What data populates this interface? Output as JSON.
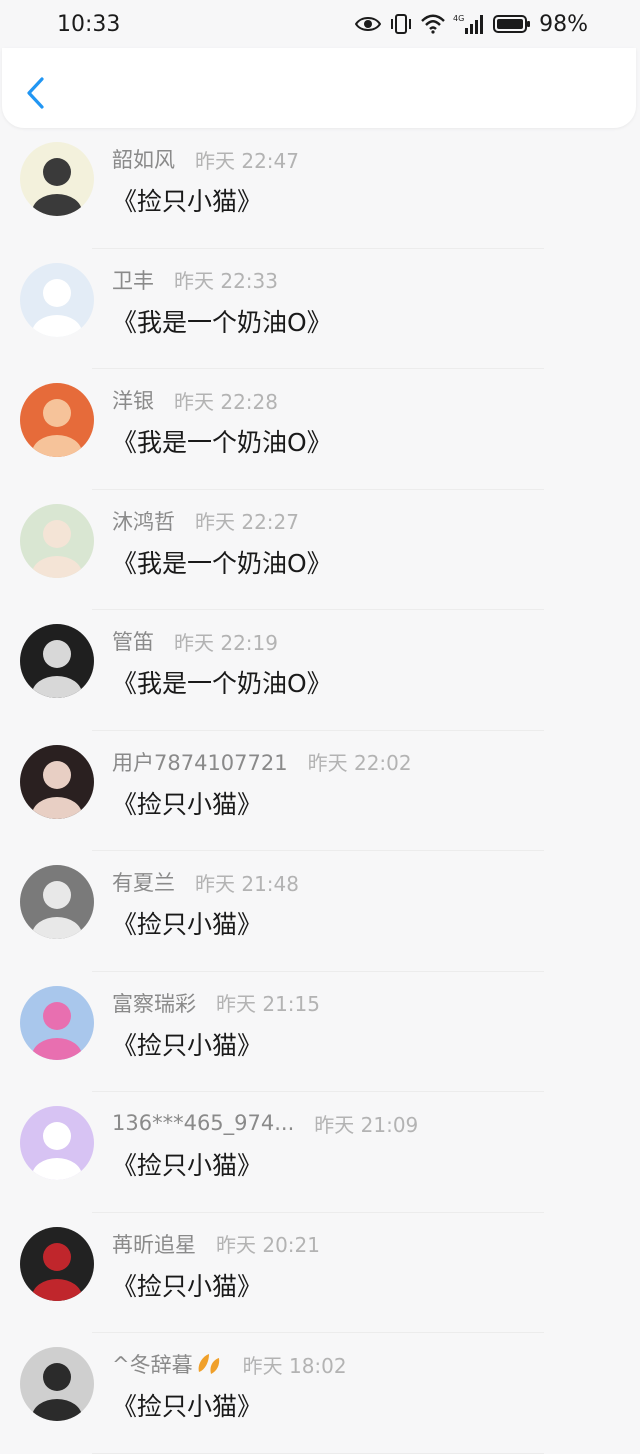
{
  "status_bar": {
    "time": "10:33",
    "battery": "98%",
    "network": "4G"
  },
  "nav": {
    "back_icon": "chevron-left-icon"
  },
  "items": [
    {
      "name": "韶如风",
      "time": "昨天 22:47",
      "title": "《捡只小猫》",
      "avatar_colors": [
        "#f3f1dc",
        "#3a3a3a"
      ]
    },
    {
      "name": "卫丰",
      "time": "昨天 22:33",
      "title": "《我是一个奶油O》",
      "avatar_colors": [
        "#e3ecf6",
        "#ffffff"
      ]
    },
    {
      "name": "洋银",
      "time": "昨天 22:28",
      "title": "《我是一个奶油O》",
      "avatar_colors": [
        "#e66b3a",
        "#f6c39a"
      ]
    },
    {
      "name": "沐鸿哲",
      "time": "昨天 22:27",
      "title": "《我是一个奶油O》",
      "avatar_colors": [
        "#d9e6d2",
        "#f4e4d6"
      ]
    },
    {
      "name": "管笛",
      "time": "昨天 22:19",
      "title": "《我是一个奶油O》",
      "avatar_colors": [
        "#1f1f1f",
        "#d8d8d8"
      ]
    },
    {
      "name": "用户7874107721",
      "time": "昨天 22:02",
      "title": "《捡只小猫》",
      "avatar_colors": [
        "#2a2020",
        "#e8cfc4"
      ]
    },
    {
      "name": "有夏兰",
      "time": "昨天 21:48",
      "title": "《捡只小猫》",
      "avatar_colors": [
        "#7a7a7a",
        "#e8e8e8"
      ]
    },
    {
      "name": "富察瑞彩",
      "time": "昨天 21:15",
      "title": "《捡只小猫》",
      "avatar_colors": [
        "#a9c7ec",
        "#e86fb0"
      ]
    },
    {
      "name": "136***465_974...",
      "time": "昨天 21:09",
      "title": "《捡只小猫》",
      "avatar_colors": [
        "#d7c3f3",
        "#ffffff"
      ]
    },
    {
      "name": "苒昕追星",
      "time": "昨天 20:21",
      "title": "《捡只小猫》",
      "avatar_colors": [
        "#222222",
        "#c0262c"
      ]
    },
    {
      "name": "^冬辞暮",
      "time": "昨天 18:02",
      "title": "《捡只小猫》",
      "avatar_colors": [
        "#cfcfcf",
        "#2b2b2b"
      ],
      "badge_icon": "autumn-leaves-icon",
      "badge_color": "#f0a02a"
    }
  ]
}
